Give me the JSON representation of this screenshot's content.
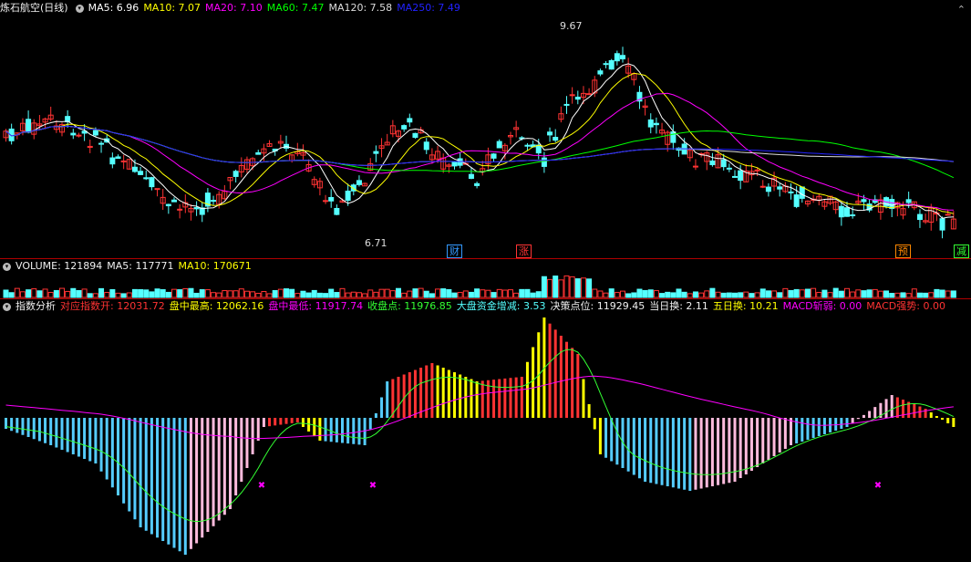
{
  "price_pane": {
    "stock_title": "炼石航空(日线)",
    "ma": [
      {
        "label": "MA5: 6.96",
        "color": "#ffffff"
      },
      {
        "label": "MA10: 7.07",
        "color": "#ffff00"
      },
      {
        "label": "MA20: 7.10",
        "color": "#ff00ff"
      },
      {
        "label": "MA60: 7.47",
        "color": "#00ff00"
      },
      {
        "label": "MA120: 7.58",
        "color": "#dddddd"
      },
      {
        "label": "MA250: 7.49",
        "color": "#2222ff"
      }
    ],
    "high_label": "9.67",
    "low_label": "6.71",
    "tags": [
      {
        "text": "财",
        "color": "#3399ff"
      },
      {
        "text": "涨",
        "color": "#ff3333"
      },
      {
        "text": "预",
        "color": "#ff8800"
      },
      {
        "text": "减",
        "color": "#33ff33"
      }
    ],
    "collapse_icon": "chevron-up-icon"
  },
  "volume_pane": {
    "items": [
      {
        "label": "VOLUME: 121894",
        "color": "#f0f0f0"
      },
      {
        "label": "MA5: 117771",
        "color": "#f0f0f0"
      },
      {
        "label": "MA10: 170671",
        "color": "#ffff00"
      }
    ]
  },
  "indicator_pane": {
    "name": "指数分析",
    "items": [
      {
        "label": "对应指数开: 12031.72",
        "color": "#ff3333"
      },
      {
        "label": "盘中最高: 12062.16",
        "color": "#ffff00"
      },
      {
        "label": "盘中最低: 11917.74",
        "color": "#ff00ff"
      },
      {
        "label": "收盘点: 11976.85",
        "color": "#33ff33"
      },
      {
        "label": "大盘资金增减: 3.53",
        "color": "#55ffff"
      },
      {
        "label": "决策点位: 11929.45",
        "color": "#f0f0f0"
      },
      {
        "label": "当日换: 2.11",
        "color": "#f0f0f0"
      },
      {
        "label": "五日换: 10.21",
        "color": "#ffff00"
      },
      {
        "label": "MACD斩弱: 0.00",
        "color": "#ff00ff"
      },
      {
        "label": "MACD强势: 0.00",
        "color": "#ff3333"
      }
    ]
  },
  "colors": {
    "up": "#ff3333",
    "down": "#55ffff",
    "ma5": "#ffffff",
    "ma10": "#ffff00",
    "ma20": "#ff00ff",
    "ma60": "#00ff00",
    "ma120": "#dddddd",
    "ma250": "#2222ff"
  }
}
